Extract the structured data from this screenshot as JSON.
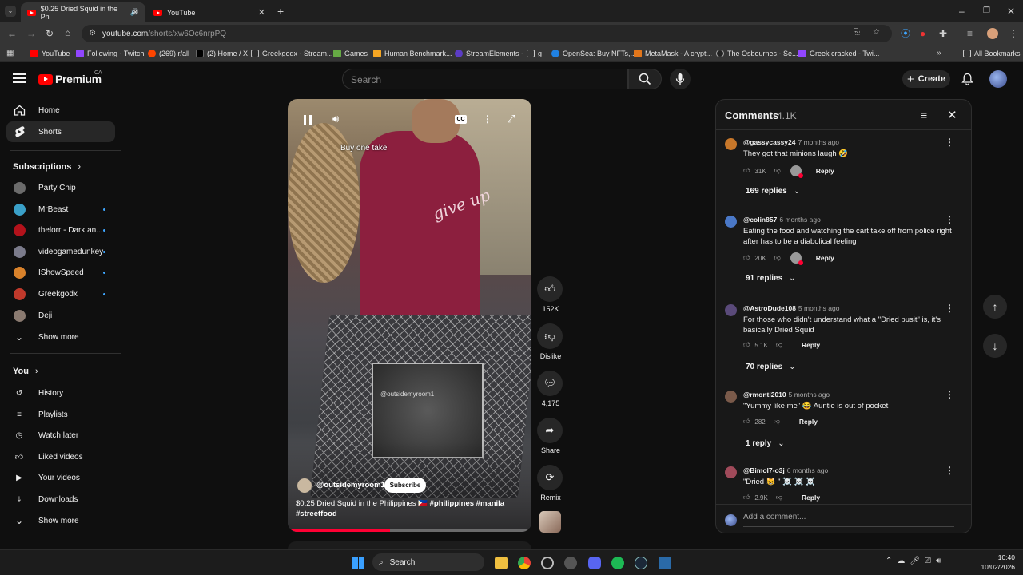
{
  "browser": {
    "tabs": [
      {
        "title": "$0.25 Dried Squid in the Ph"
      },
      {
        "title": "YouTube"
      }
    ],
    "url_host": "youtube.com",
    "url_path": "/shorts/xw6Oc6nrpPQ",
    "bookmarks": [
      "YouTube",
      "Following - Twitch",
      "(269) r/all",
      "(2) Home / X",
      "Greekgodx - Stream...",
      "Games",
      "Human Benchmark...",
      "StreamElements -",
      "g",
      "OpenSea: Buy NFTs,...",
      "MetaMask - A crypt...",
      "The Osbournes - Se...",
      "Greek cracked - Twi..."
    ],
    "all_bookmarks": "All Bookmarks"
  },
  "header": {
    "logo_text": "Premium",
    "region": "CA",
    "search_placeholder": "Search",
    "create_label": "Create"
  },
  "sidebar": {
    "nav": [
      {
        "label": "Home"
      },
      {
        "label": "Shorts"
      }
    ],
    "subscriptions_title": "Subscriptions",
    "subscriptions": [
      {
        "label": "Party Chip",
        "color": "#6b6b6b"
      },
      {
        "label": "MrBeast",
        "color": "#3aa0c8"
      },
      {
        "label": "thelorr - Dark an...",
        "color": "#b3121b"
      },
      {
        "label": "videogamedunkey",
        "color": "#7b7b8b"
      },
      {
        "label": "IShowSpeed",
        "color": "#d9822b"
      },
      {
        "label": "Greekgodx",
        "color": "#c0392b"
      },
      {
        "label": "Deji",
        "color": "#8a7a70"
      }
    ],
    "show_more_subs": "Show more",
    "you_title": "You",
    "you_items": [
      {
        "label": "History"
      },
      {
        "label": "Playlists"
      },
      {
        "label": "Watch later"
      },
      {
        "label": "Liked videos"
      },
      {
        "label": "Your videos"
      },
      {
        "label": "Downloads"
      },
      {
        "label": "Show more"
      }
    ]
  },
  "video": {
    "overlay_text": "Buy one take",
    "watermark": "@outsidemyroom1",
    "channel": "@outsidemyroom1",
    "subscribe_label": "Subscribe",
    "title": "$0.25 Dried Squid in the Philippines 🇵🇭 ",
    "hashtags": "#philippines #manila",
    "hashtags2": "#streetfood",
    "sign_text": "give up"
  },
  "actions": {
    "likes": "152K",
    "dislike": "Dislike",
    "comments": "4,175",
    "share": "Share",
    "remix": "Remix"
  },
  "comments": {
    "title": "Comments",
    "count": "4.1K",
    "add_placeholder": "Add a comment...",
    "items": [
      {
        "user": "@gassycassy24",
        "time": "7 months ago",
        "text": "They got that minions laugh 🤣",
        "likes": "31K",
        "replies": "169 replies",
        "avatar": "#c7772a"
      },
      {
        "user": "@colin857",
        "time": "6 months ago",
        "text": "Eating the food and watching the cart take off from police right after has to be a diabolical feeling",
        "likes": "20K",
        "replies": "91 replies",
        "avatar": "#4a78c7"
      },
      {
        "user": "@AstroDude108",
        "time": "5 months ago",
        "text": "For those who didn't understand what a \"Dried pusit\" is, it's basically Dried Squid",
        "likes": "5.1K",
        "replies": "70 replies",
        "avatar": "#5a4a7a"
      },
      {
        "user": "@rmonti2010",
        "time": "5 months ago",
        "text": "\"Yummy like me\" 😂 Auntie is out of pocket",
        "likes": "282",
        "replies": "1 reply",
        "avatar": "#7a5a4a"
      },
      {
        "user": "@Bimol7-o3j",
        "time": "6 months ago",
        "text": "\"Dried 😸 \" ☠️ ☠️ ☠️",
        "likes": "2.9K",
        "replies": "",
        "avatar": "#a04a5a"
      }
    ],
    "reply_label": "Reply"
  },
  "taskbar": {
    "search_label": "Search",
    "time": "10:40",
    "date": "10/02/2026"
  }
}
